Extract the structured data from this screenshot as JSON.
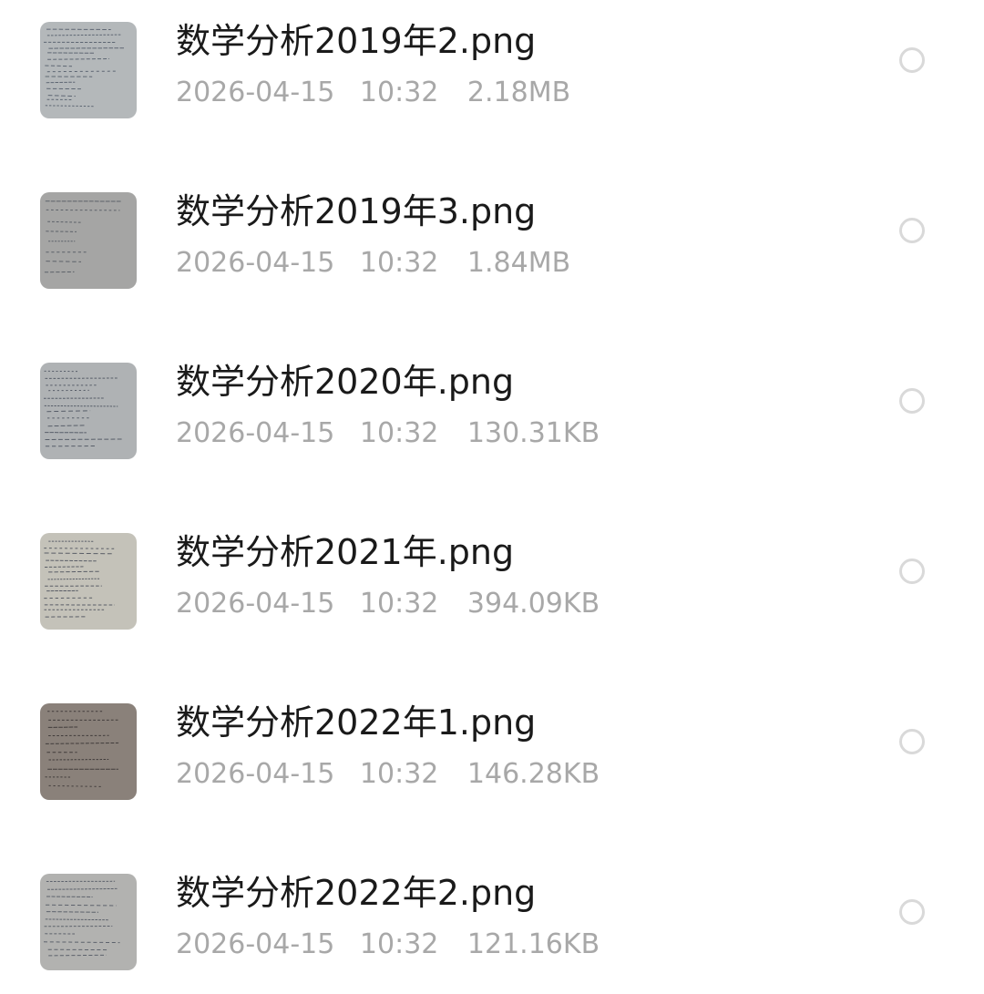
{
  "files": [
    {
      "name": "数学分析2019年2.png",
      "date": "2026-04-15",
      "time": "10:32",
      "size": "2.18MB",
      "selected": false,
      "thumbnail": "handwritten-notes-thumbnail"
    },
    {
      "name": "数学分析2019年3.png",
      "date": "2026-04-15",
      "time": "10:32",
      "size": "1.84MB",
      "selected": false,
      "thumbnail": "handwritten-notes-thumbnail"
    },
    {
      "name": "数学分析2020年.png",
      "date": "2026-04-15",
      "time": "10:32",
      "size": "130.31KB",
      "selected": false,
      "thumbnail": "handwritten-notes-thumbnail"
    },
    {
      "name": "数学分析2021年.png",
      "date": "2026-04-15",
      "time": "10:32",
      "size": "394.09KB",
      "selected": false,
      "thumbnail": "handwritten-notes-thumbnail"
    },
    {
      "name": "数学分析2022年1.png",
      "date": "2026-04-15",
      "time": "10:32",
      "size": "146.28KB",
      "selected": false,
      "thumbnail": "handwritten-notes-thumbnail"
    },
    {
      "name": "数学分析2022年2.png",
      "date": "2026-04-15",
      "time": "10:32",
      "size": "121.16KB",
      "selected": false,
      "thumbnail": "handwritten-notes-thumbnail"
    }
  ],
  "colors": {
    "name_text": "#1a1a1a",
    "meta_text": "#a8a8a8",
    "radio_border": "#d9d9d9"
  }
}
